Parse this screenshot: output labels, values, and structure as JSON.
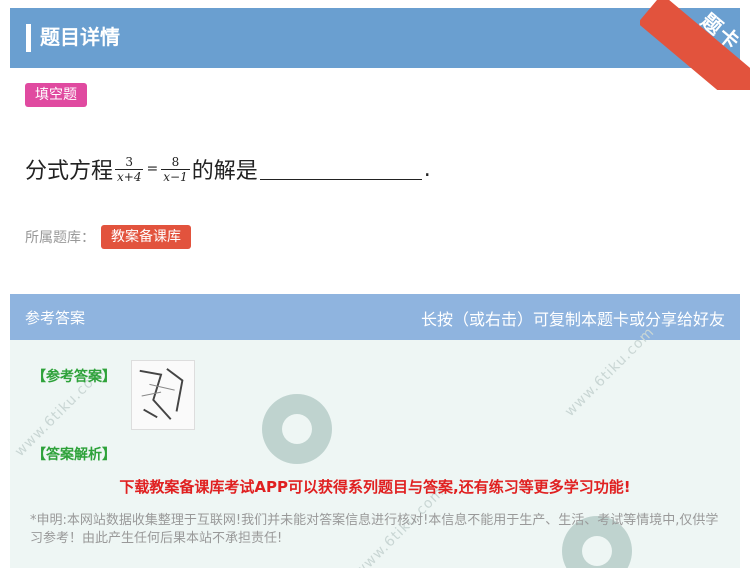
{
  "header": {
    "title": "题目详情"
  },
  "ribbon": {
    "text": "题卡"
  },
  "question_type": "填空题",
  "question": {
    "prefix": "分式方程",
    "frac1": {
      "num": "3",
      "den": "x+4"
    },
    "equals": "=",
    "frac2": {
      "num": "8",
      "den": "x−1"
    },
    "suffix": "的解是",
    "end": "."
  },
  "bank": {
    "label": "所属题库：",
    "tag": "教案备课库"
  },
  "answer": {
    "head_left": "参考答案",
    "head_right": "长按（或右击）可复制本题卡或分享给好友",
    "ref_label": "【参考答案】",
    "analysis_label": "【答案解析】",
    "promo": "下载教案备课库考试APP可以获得系列题目与答案,还有练习等更多学习功能!",
    "disclaimer": "*申明:本网站数据收集整理于互联网!我们并未能对答案信息进行核对!本信息不能用于生产、生活、考试等情境中,仅供学习参考！由此产生任何后果本站不承担责任!"
  },
  "watermark": {
    "text": "www.6tiku.com"
  }
}
